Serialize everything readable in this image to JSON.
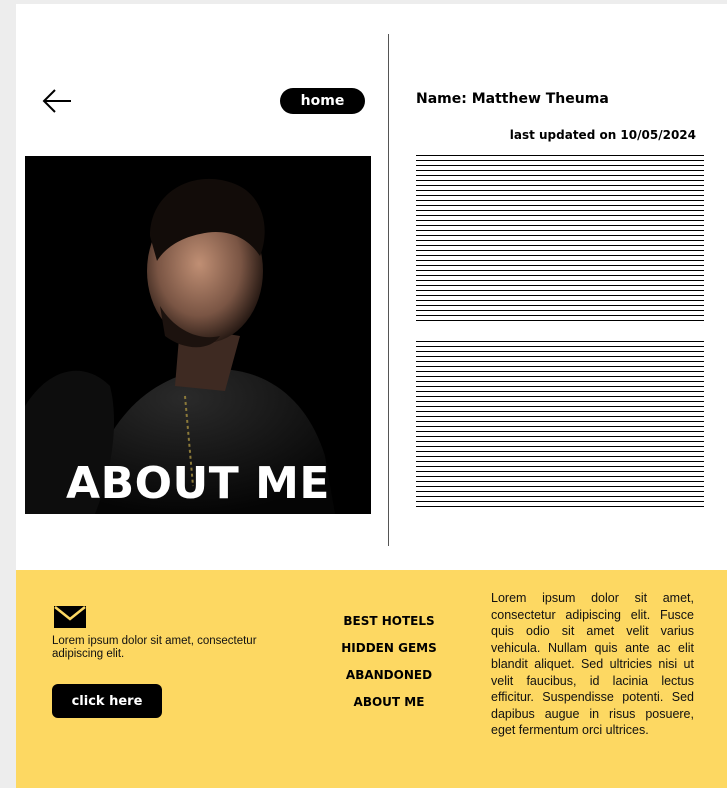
{
  "header": {
    "home_label": "home"
  },
  "hero": {
    "title": "ABOUT ME"
  },
  "profile": {
    "name": "Name: Matthew Theuma",
    "last_updated": "last updated on 10/05/2024"
  },
  "footer": {
    "blurb": "Lorem ipsum dolor sit amet, consectetur adipiscing elit.",
    "cta_label": "click here",
    "nav": [
      "BEST HOTELS",
      "HIDDEN GEMS",
      "ABANDONED",
      "ABOUT ME"
    ],
    "paragraph": "Lorem ipsum dolor sit amet, consectetur adipiscing elit. Fusce quis odio sit amet velit varius vehicula. Nullam quis ante ac elit blandit aliquet. Sed ultricies nisi ut velit faucibus, id lacinia lectus efficitur. Suspendisse potenti. Sed dapibus augue in risus posuere, eget fermentum orci ultrices."
  },
  "icons": {
    "back": "arrow-left-icon",
    "mail": "envelope-icon"
  },
  "colors": {
    "footer_bg": "#fdd862",
    "button_bg": "#000000",
    "button_text": "#ffffff"
  }
}
